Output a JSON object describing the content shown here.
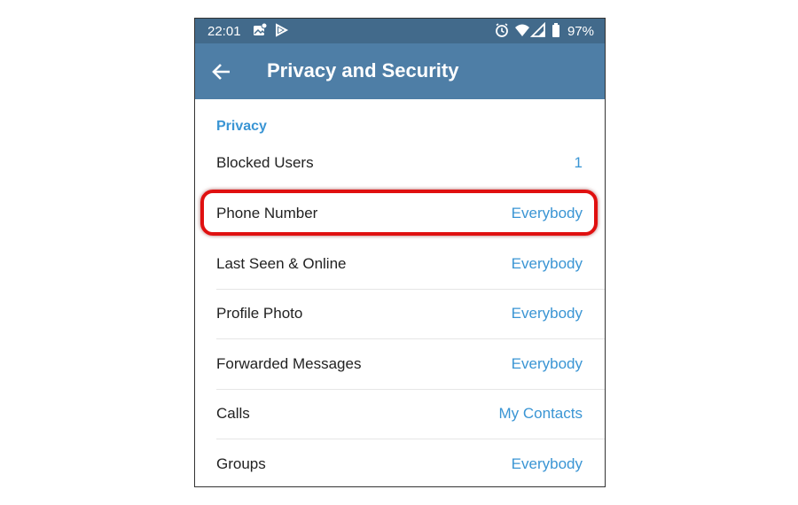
{
  "status_bar": {
    "time": "22:01",
    "battery_percent": "97%",
    "icons": [
      "photo-notification-icon",
      "play-store-icon",
      "alarm-icon",
      "wifi-icon",
      "signal-icon",
      "battery-icon"
    ]
  },
  "app_bar": {
    "back_icon": "arrow-left-icon",
    "title": "Privacy and Security"
  },
  "colors": {
    "status_bar": "#426a8b",
    "app_bar": "#4e7ea6",
    "accent": "#3a95d4",
    "highlight": "#e01010"
  },
  "privacy": {
    "header": "Privacy",
    "rows": [
      {
        "label": "Blocked Users",
        "value": "1"
      },
      {
        "label": "Phone Number",
        "value": "Everybody"
      },
      {
        "label": "Last Seen & Online",
        "value": "Everybody"
      },
      {
        "label": "Profile Photo",
        "value": "Everybody"
      },
      {
        "label": "Forwarded Messages",
        "value": "Everybody"
      },
      {
        "label": "Calls",
        "value": "My Contacts"
      },
      {
        "label": "Groups",
        "value": "Everybody"
      }
    ]
  }
}
